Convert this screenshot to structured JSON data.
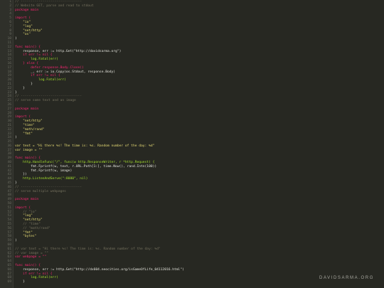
{
  "watermark": "DAVIDSARMA.ORG",
  "colors": {
    "background": "#272822",
    "keyword": "#f92672",
    "string": "#e6db74",
    "function": "#a6e22e",
    "comment": "#75715e",
    "number": "#ae81ff",
    "type": "#66d9ef",
    "text": "#e6e6df"
  },
  "lines": [
    {
      "n": "1",
      "t": "// -------------------------------",
      "c": "cm"
    },
    {
      "n": "2",
      "t": "// Website GET, parse and read to stdout",
      "c": "cm"
    },
    {
      "n": "3",
      "t": "package main",
      "c": "kw"
    },
    {
      "n": "4",
      "t": "",
      "c": ""
    },
    {
      "n": "5",
      "t": "import (",
      "c": "kw"
    },
    {
      "n": "6",
      "t": "    \"io\"",
      "c": "str"
    },
    {
      "n": "7",
      "t": "    \"log\"",
      "c": "str"
    },
    {
      "n": "8",
      "t": "    \"net/http\"",
      "c": "str"
    },
    {
      "n": "9",
      "t": "    \"os\"",
      "c": "str"
    },
    {
      "n": "10",
      "t": ")",
      "c": ""
    },
    {
      "n": "11",
      "t": "",
      "c": ""
    },
    {
      "n": "12",
      "t": "func main() {",
      "c": "kw"
    },
    {
      "n": "13",
      "t": "    response, err := http.Get(\"http://davidsarma.org\")",
      "c": ""
    },
    {
      "n": "14",
      "t": "    if err != nil {",
      "c": "kw"
    },
    {
      "n": "15",
      "t": "        log.Fatal(err)",
      "c": "fn"
    },
    {
      "n": "16",
      "t": "    } else {",
      "c": "kw"
    },
    {
      "n": "17",
      "t": "        defer response.Body.Close()",
      "c": "kw"
    },
    {
      "n": "18",
      "t": "        _, err := io.Copy(os.Stdout, response.Body)",
      "c": ""
    },
    {
      "n": "19",
      "t": "        if err != nil {",
      "c": "kw"
    },
    {
      "n": "20",
      "t": "            log.Fatal(err)",
      "c": "fn"
    },
    {
      "n": "21",
      "t": "        }",
      "c": ""
    },
    {
      "n": "22",
      "t": "    }",
      "c": ""
    },
    {
      "n": "23",
      "t": "}",
      "c": ""
    },
    {
      "n": "24",
      "t": "// -------------------------------",
      "c": "cm"
    },
    {
      "n": "25",
      "t": "// serve some text and an image",
      "c": "cm"
    },
    {
      "n": "26",
      "t": "",
      "c": ""
    },
    {
      "n": "27",
      "t": "package main",
      "c": "kw"
    },
    {
      "n": "28",
      "t": "",
      "c": ""
    },
    {
      "n": "29",
      "t": "import (",
      "c": "kw"
    },
    {
      "n": "30",
      "t": "    \"net/http\"",
      "c": "str"
    },
    {
      "n": "31",
      "t": "    \"time\"",
      "c": "str"
    },
    {
      "n": "32",
      "t": "    \"math/rand\"",
      "c": "str"
    },
    {
      "n": "33",
      "t": "    \"fmt\"",
      "c": "str"
    },
    {
      "n": "34",
      "t": ")",
      "c": ""
    },
    {
      "n": "35",
      "t": "",
      "c": ""
    },
    {
      "n": "36",
      "t": "var text = \"Hi there %s! The time is: %s. Random number of the day: %d\"",
      "c": "str"
    },
    {
      "n": "37",
      "t": "var image = \"\"",
      "c": "str"
    },
    {
      "n": "38",
      "t": "",
      "c": ""
    },
    {
      "n": "39",
      "t": "func main() {",
      "c": "kw"
    },
    {
      "n": "40",
      "t": "    http.HandleFunc(\"/\", func(w http.ResponseWriter, r *http.Request) {",
      "c": "fn"
    },
    {
      "n": "41",
      "t": "        fmt.Fprintf(w, text, r.URL.Path[1:], time.Now(), rand.Intn(100))",
      "c": ""
    },
    {
      "n": "42",
      "t": "        fmt.Fprintf(w, image)",
      "c": ""
    },
    {
      "n": "43",
      "t": "    })",
      "c": ""
    },
    {
      "n": "44",
      "t": "    http.ListenAndServe(\":8080\", nil)",
      "c": "fn"
    },
    {
      "n": "45",
      "t": "}",
      "c": ""
    },
    {
      "n": "46",
      "t": "// -------------------------------",
      "c": "cm"
    },
    {
      "n": "47",
      "t": "// serve multiple webpages",
      "c": "cm"
    },
    {
      "n": "48",
      "t": "",
      "c": ""
    },
    {
      "n": "49",
      "t": "package main",
      "c": "kw"
    },
    {
      "n": "50",
      "t": "",
      "c": ""
    },
    {
      "n": "51",
      "t": "import (",
      "c": "kw"
    },
    {
      "n": "52",
      "t": "    // \"io\"",
      "c": "cm"
    },
    {
      "n": "53",
      "t": "    \"log\"",
      "c": "str"
    },
    {
      "n": "54",
      "t": "    \"net/http\"",
      "c": "str"
    },
    {
      "n": "55",
      "t": "    // \"time\"",
      "c": "cm"
    },
    {
      "n": "56",
      "t": "    // \"math/rand\"",
      "c": "cm"
    },
    {
      "n": "57",
      "t": "    \"fmt\"",
      "c": "str"
    },
    {
      "n": "58",
      "t": "    \"bytes\"",
      "c": "str"
    },
    {
      "n": "59",
      "t": ")",
      "c": ""
    },
    {
      "n": "60",
      "t": "",
      "c": ""
    },
    {
      "n": "61",
      "t": "// var text = \"Hi there %s! The time is: %s. Random number of the day: %d\"",
      "c": "cm"
    },
    {
      "n": "62",
      "t": "// var image = \"\"",
      "c": "cm"
    },
    {
      "n": "63",
      "t": "var webpage = \"\"",
      "c": "kw"
    },
    {
      "n": "64",
      "t": "",
      "c": ""
    },
    {
      "n": "65",
      "t": "func main() {",
      "c": "kw"
    },
    {
      "n": "66",
      "t": "    response, err := http.Get(\"http://dx604.neocities.org/isGameOfLife_04112016.html\")",
      "c": ""
    },
    {
      "n": "67",
      "t": "    if err != nil {",
      "c": "kw"
    },
    {
      "n": "68",
      "t": "        log.Fatal(err)",
      "c": "fn"
    },
    {
      "n": "69",
      "t": "    }",
      "c": ""
    }
  ]
}
